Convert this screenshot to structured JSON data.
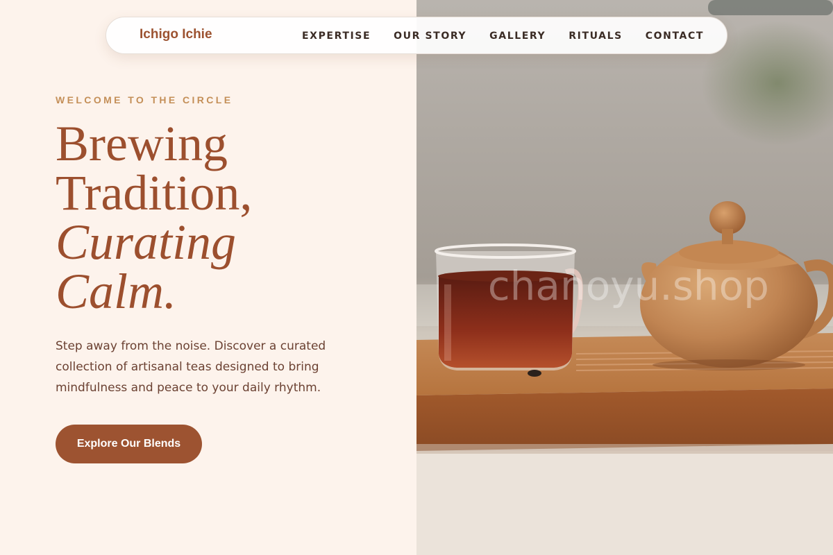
{
  "nav": {
    "brand": "Ichigo Ichie",
    "links": [
      {
        "label": "EXPERTISE"
      },
      {
        "label": "OUR STORY"
      },
      {
        "label": "GALLERY"
      },
      {
        "label": "RITUALS"
      },
      {
        "label": "CONTACT"
      }
    ]
  },
  "hero": {
    "eyebrow": "WELCOME TO THE CIRCLE",
    "headline_line1": "Brewing",
    "headline_line2": "Tradition,",
    "headline_line3": "Curating",
    "headline_line4": "Calm.",
    "lead": "Step away from the noise. Discover a curated collection of artisanal teas designed to bring mindfulness and peace to your daily rhythm.",
    "cta_label": "Explore Our Blends"
  },
  "photo": {
    "watermark": "chanoyu.shop",
    "subject": "glass cup of red tea and clay teapot on wooden tea tray"
  },
  "colors": {
    "background": "#fdf3ec",
    "accent": "#9d5331",
    "eyebrow": "#c48f58",
    "body_text": "#6b4132",
    "nav_text": "#3b2c25"
  }
}
